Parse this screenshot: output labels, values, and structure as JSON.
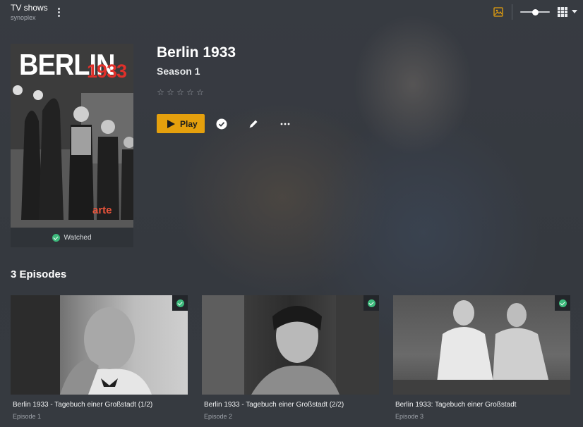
{
  "app": {
    "title": "TV shows",
    "server": "synoplex"
  },
  "toolbar": {
    "more_icon": "kebab-vertical-icon",
    "backdrop_icon": "image-icon",
    "size_slider_value": 0.5,
    "view_icon": "grid-view-icon",
    "accent_color": "#e5a00d"
  },
  "poster": {
    "title_text": "BERLIN",
    "year_text": "1933",
    "logo_text": "arte",
    "status": "Watched"
  },
  "details": {
    "show_title": "Berlin 1933",
    "season_title": "Season 1",
    "rating_stars": 0,
    "play_label": "Play"
  },
  "episodes": {
    "heading": "3 Episodes",
    "items": [
      {
        "title": "Berlin 1933 - Tagebuch einer Großstadt (1/2)",
        "subtitle": "Episode 1",
        "watched": true
      },
      {
        "title": "Berlin 1933 - Tagebuch einer Großstadt (2/2)",
        "subtitle": "Episode 2",
        "watched": true
      },
      {
        "title": "Berlin 1933: Tagebuch einer Großstadt",
        "subtitle": "Episode 3",
        "watched": true
      }
    ]
  }
}
